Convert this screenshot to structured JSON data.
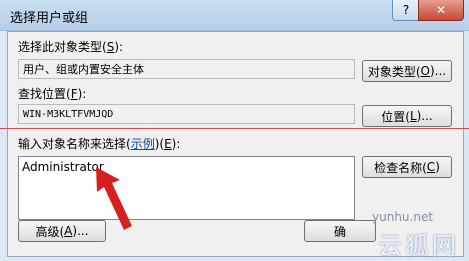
{
  "window": {
    "title": "选择用户或组",
    "help_button": "?",
    "close_button": "✕"
  },
  "object_type": {
    "label": "选择此对象类型(S):",
    "label_main": "选择此对象类型(",
    "label_key": "S",
    "label_end": "):",
    "value": "用户、组或内置安全主体",
    "button_main": "对象类型(",
    "button_key": "O",
    "button_end": ")..."
  },
  "location": {
    "label_main": "查找位置(",
    "label_key": "F",
    "label_end": "):",
    "value": "WIN-M3KLTFVMJQD",
    "button_main": "位置(",
    "button_key": "L",
    "button_end": ")..."
  },
  "names": {
    "label_main": "输入对象名称来选择(",
    "label_link": "示例",
    "label_mid": ")(",
    "label_key": "E",
    "label_end": "):",
    "value": "Administrator",
    "check_button_main": "检查名称(",
    "check_button_key": "C",
    "check_button_end": ")"
  },
  "footer": {
    "advanced_main": "高级(",
    "advanced_key": "A",
    "advanced_end": ")...",
    "ok_label": "确"
  },
  "watermark": {
    "url": "yunhu.net",
    "brand": "云狐网"
  },
  "colors": {
    "annotation_red": "#d62020",
    "link_blue": "#0645ad"
  }
}
